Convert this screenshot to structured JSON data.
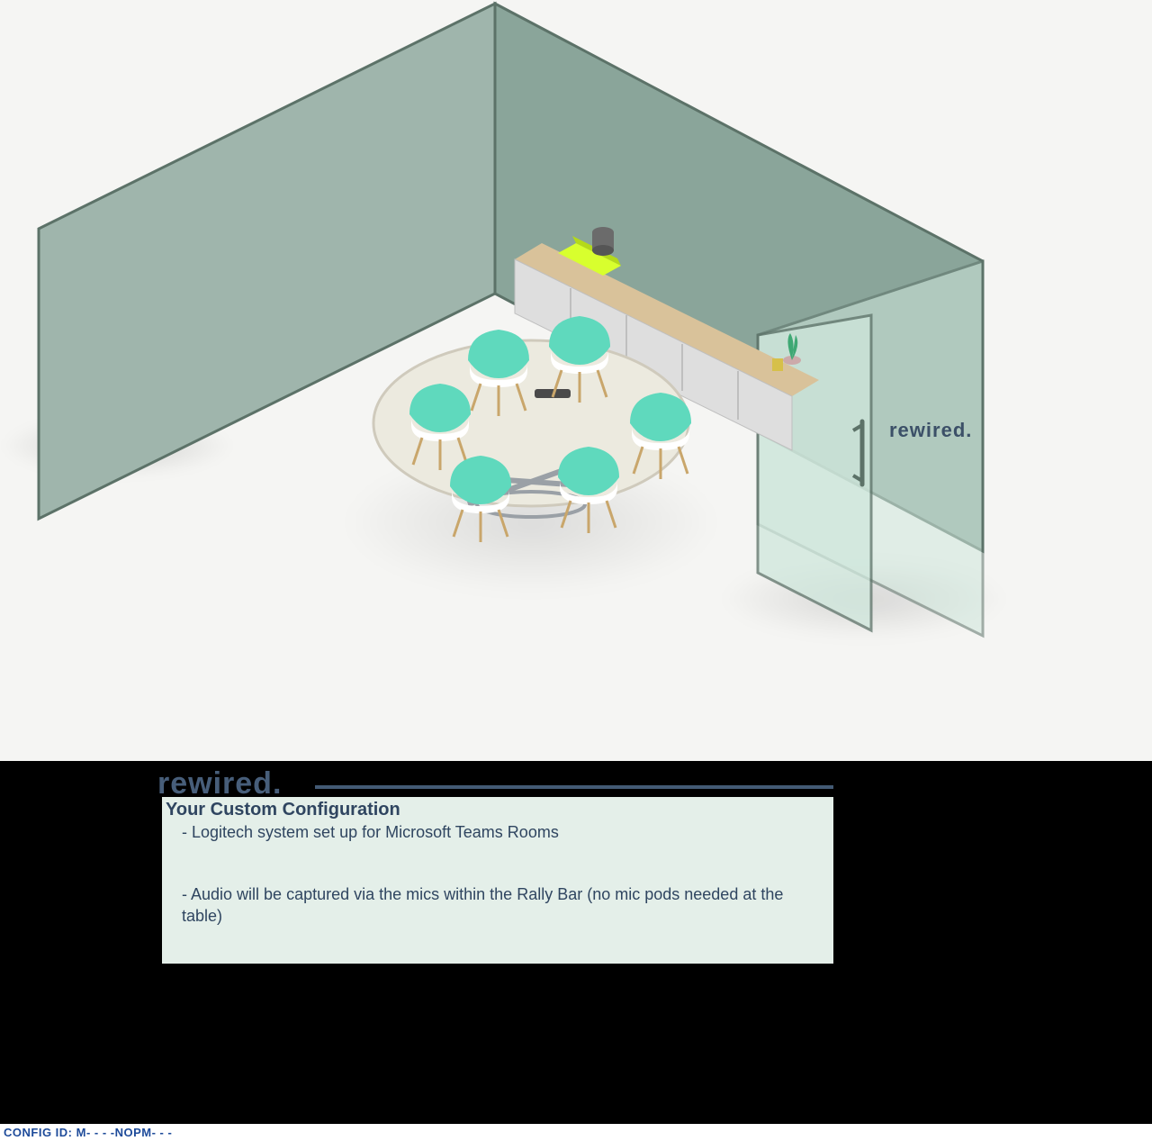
{
  "brand": "rewired.",
  "door_brand": "rewired.",
  "config_card": {
    "title": "Your Custom Configuration",
    "items": [
      "Logitech system set up for Microsoft Teams Rooms",
      "Audio will be captured via the mics within the Rally Bar (no mic pods needed at the table)"
    ]
  },
  "config_id_label": "CONFIG ID:",
  "config_id_value": "M-   -     -       -NOPM-    -    -",
  "colors": {
    "wall": "#9fb5ac",
    "wall_edge": "#5c7268",
    "glass": "#cfe7dc",
    "accent_teal": "#5fd9bd",
    "wood": "#d9c29a",
    "brand_navy": "#475e7a",
    "card_bg": "#e4efe9"
  }
}
